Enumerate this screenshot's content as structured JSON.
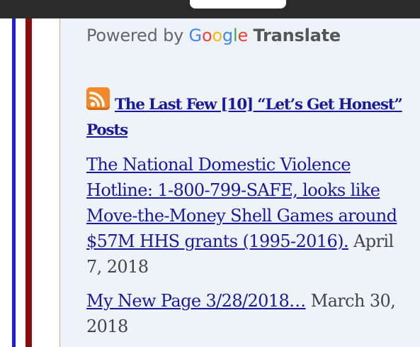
{
  "translate": {
    "powered_by": "Powered by",
    "google_letters": [
      "G",
      "o",
      "o",
      "g",
      "l",
      "e"
    ],
    "google_colors": [
      "#4285F4",
      "#EA4335",
      "#FBBC05",
      "#4285F4",
      "#34A853",
      "#EA4335"
    ],
    "translate_label": "Translate"
  },
  "feed": {
    "icon": "rss-icon",
    "title": "The Last Few [10] “Let’s Get Honest” Posts"
  },
  "posts": [
    {
      "title": "The National Domestic Violence Hotline: 1-800-799-SAFE, looks like Move-the-Money Shell Games around $57M HHS grants (1995-2016).",
      "date": "April 7, 2018"
    },
    {
      "title": "My New Page 3/28/2018…",
      "date": "March 30, 2018"
    }
  ],
  "colors": {
    "link": "#1a1a9a",
    "background": "#eef3fa",
    "stripe_blue": "#1f1fe0",
    "stripe_red": "#8b0d0d",
    "rss_orange": "#f28a2c"
  }
}
